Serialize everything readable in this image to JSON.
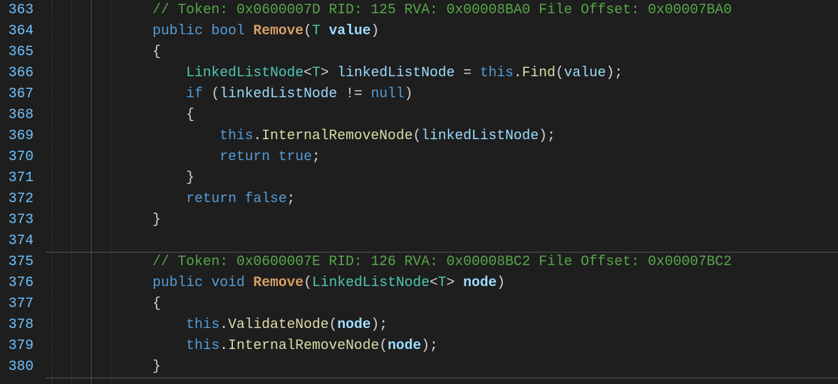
{
  "startLine": 363,
  "guides": [
    {
      "col": 8,
      "style": "dashed"
    },
    {
      "col": 36,
      "style": "dashed"
    },
    {
      "col": 64,
      "style": "solid"
    },
    {
      "col": 92,
      "style": "dashed"
    }
  ],
  "separators": [
    360,
    540
  ],
  "lines": [
    {
      "n": 363,
      "indent": 3,
      "tokens": [
        {
          "t": "c",
          "s": "// Token: 0x0600007D RID: 125 RVA: 0x00008BA0 File Offset: 0x00007BA0"
        }
      ]
    },
    {
      "n": 364,
      "indent": 3,
      "tokens": [
        {
          "t": "k",
          "s": "public "
        },
        {
          "t": "k",
          "s": "bool "
        },
        {
          "t": "mo b",
          "s": "Remove"
        },
        {
          "t": "p",
          "s": "("
        },
        {
          "t": "t",
          "s": "T"
        },
        {
          "t": "p",
          "s": " "
        },
        {
          "t": "v b",
          "s": "value"
        },
        {
          "t": "p",
          "s": ")"
        }
      ]
    },
    {
      "n": 365,
      "indent": 3,
      "tokens": [
        {
          "t": "p",
          "s": "{"
        }
      ]
    },
    {
      "n": 366,
      "indent": 4,
      "tokens": [
        {
          "t": "t",
          "s": "LinkedListNode"
        },
        {
          "t": "p",
          "s": "<"
        },
        {
          "t": "t",
          "s": "T"
        },
        {
          "t": "p",
          "s": "> "
        },
        {
          "t": "v",
          "s": "linkedListNode"
        },
        {
          "t": "p",
          "s": " = "
        },
        {
          "t": "k",
          "s": "this"
        },
        {
          "t": "p",
          "s": "."
        },
        {
          "t": "m",
          "s": "Find"
        },
        {
          "t": "p",
          "s": "("
        },
        {
          "t": "v",
          "s": "value"
        },
        {
          "t": "p",
          "s": ");"
        }
      ]
    },
    {
      "n": 367,
      "indent": 4,
      "tokens": [
        {
          "t": "k",
          "s": "if"
        },
        {
          "t": "p",
          "s": " ("
        },
        {
          "t": "v",
          "s": "linkedListNode"
        },
        {
          "t": "p",
          "s": " != "
        },
        {
          "t": "k",
          "s": "null"
        },
        {
          "t": "p",
          "s": ")"
        }
      ]
    },
    {
      "n": 368,
      "indent": 4,
      "tokens": [
        {
          "t": "p",
          "s": "{"
        }
      ]
    },
    {
      "n": 369,
      "indent": 5,
      "tokens": [
        {
          "t": "k",
          "s": "this"
        },
        {
          "t": "p",
          "s": "."
        },
        {
          "t": "m",
          "s": "InternalRemoveNode"
        },
        {
          "t": "p",
          "s": "("
        },
        {
          "t": "v",
          "s": "linkedListNode"
        },
        {
          "t": "p",
          "s": ");"
        }
      ]
    },
    {
      "n": 370,
      "indent": 5,
      "tokens": [
        {
          "t": "k",
          "s": "return"
        },
        {
          "t": "p",
          "s": " "
        },
        {
          "t": "k",
          "s": "true"
        },
        {
          "t": "p",
          "s": ";"
        }
      ]
    },
    {
      "n": 371,
      "indent": 4,
      "tokens": [
        {
          "t": "p",
          "s": "}"
        }
      ]
    },
    {
      "n": 372,
      "indent": 4,
      "tokens": [
        {
          "t": "k",
          "s": "return"
        },
        {
          "t": "p",
          "s": " "
        },
        {
          "t": "k",
          "s": "false"
        },
        {
          "t": "p",
          "s": ";"
        }
      ]
    },
    {
      "n": 373,
      "indent": 3,
      "tokens": [
        {
          "t": "p",
          "s": "}"
        }
      ]
    },
    {
      "n": 374,
      "indent": 0,
      "tokens": []
    },
    {
      "n": 375,
      "indent": 3,
      "tokens": [
        {
          "t": "c",
          "s": "// Token: 0x0600007E RID: 126 RVA: 0x00008BC2 File Offset: 0x00007BC2"
        }
      ]
    },
    {
      "n": 376,
      "indent": 3,
      "tokens": [
        {
          "t": "k",
          "s": "public "
        },
        {
          "t": "k",
          "s": "void "
        },
        {
          "t": "mo b",
          "s": "Remove"
        },
        {
          "t": "p",
          "s": "("
        },
        {
          "t": "t",
          "s": "LinkedListNode"
        },
        {
          "t": "p",
          "s": "<"
        },
        {
          "t": "t",
          "s": "T"
        },
        {
          "t": "p",
          "s": "> "
        },
        {
          "t": "v b",
          "s": "node"
        },
        {
          "t": "p",
          "s": ")"
        }
      ]
    },
    {
      "n": 377,
      "indent": 3,
      "tokens": [
        {
          "t": "p",
          "s": "{"
        }
      ]
    },
    {
      "n": 378,
      "indent": 4,
      "tokens": [
        {
          "t": "k",
          "s": "this"
        },
        {
          "t": "p",
          "s": "."
        },
        {
          "t": "m",
          "s": "ValidateNode"
        },
        {
          "t": "p",
          "s": "("
        },
        {
          "t": "v b",
          "s": "node"
        },
        {
          "t": "p",
          "s": ");"
        }
      ]
    },
    {
      "n": 379,
      "indent": 4,
      "tokens": [
        {
          "t": "k",
          "s": "this"
        },
        {
          "t": "p",
          "s": "."
        },
        {
          "t": "m",
          "s": "InternalRemoveNode"
        },
        {
          "t": "p",
          "s": "("
        },
        {
          "t": "v b",
          "s": "node"
        },
        {
          "t": "p",
          "s": ");"
        }
      ]
    },
    {
      "n": 380,
      "indent": 3,
      "tokens": [
        {
          "t": "p",
          "s": "}"
        }
      ]
    }
  ]
}
